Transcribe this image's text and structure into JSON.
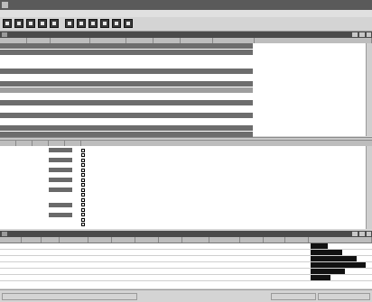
{
  "window": {
    "title": ""
  },
  "menu": [
    {
      "label": ""
    },
    {
      "label": ""
    },
    {
      "label": ""
    },
    {
      "label": ""
    },
    {
      "label": ""
    },
    {
      "label": ""
    },
    {
      "label": ""
    },
    {
      "label": ""
    }
  ],
  "toolbar": [
    {
      "icon": "start-capture-icon"
    },
    {
      "icon": "save-icon"
    },
    {
      "icon": "filter-icon"
    },
    {
      "icon": "stop-capture-icon"
    },
    {
      "icon": "restart-icon"
    },
    {
      "icon": "expert-icon"
    },
    {
      "icon": "options-icon"
    },
    {
      "icon": "print-icon"
    },
    {
      "icon": "list-view-icon"
    },
    {
      "icon": "statistics-icon"
    },
    {
      "icon": "help-icon"
    }
  ],
  "packet_pane": {
    "title": "",
    "columns": [
      "",
      "",
      "",
      "",
      "",
      "",
      "",
      "",
      ""
    ],
    "rows": [
      {
        "c": [
          "",
          "",
          "",
          "",
          "",
          "",
          "",
          "",
          ""
        ],
        "style": "dark"
      },
      {
        "c": [
          "",
          "",
          "",
          "",
          "",
          "",
          "",
          "",
          ""
        ],
        "style": "dark"
      },
      {
        "c": [
          "",
          "",
          "",
          "",
          "",
          "",
          "",
          "",
          ""
        ],
        "style": "light"
      },
      {
        "c": [
          "",
          "",
          "",
          "",
          "",
          "",
          "",
          "",
          ""
        ],
        "style": "light"
      },
      {
        "c": [
          "",
          "",
          "",
          "",
          "",
          "",
          "",
          "",
          ""
        ],
        "style": "dark"
      },
      {
        "c": [
          "",
          "",
          "",
          "",
          "",
          "",
          "",
          "",
          ""
        ],
        "style": "light"
      },
      {
        "c": [
          "",
          "",
          "",
          "",
          "",
          "",
          "",
          "",
          ""
        ],
        "style": "dark"
      },
      {
        "c": [
          "",
          "",
          "",
          "",
          "",
          "",
          "",
          "",
          ""
        ],
        "style": "sel"
      },
      {
        "c": [
          "",
          "",
          "",
          "",
          "",
          "",
          "",
          "",
          ""
        ],
        "style": "light"
      },
      {
        "c": [
          "",
          "",
          "",
          "",
          "",
          "",
          "",
          "",
          ""
        ],
        "style": "dark"
      },
      {
        "c": [
          "",
          "",
          "",
          "",
          "",
          "",
          "",
          "",
          ""
        ],
        "style": "light"
      },
      {
        "c": [
          "",
          "",
          "",
          "",
          "",
          "",
          "",
          "",
          ""
        ],
        "style": "dark"
      },
      {
        "c": [
          "",
          "",
          "",
          "",
          "",
          "",
          "",
          "",
          ""
        ],
        "style": "light"
      },
      {
        "c": [
          "",
          "",
          "",
          "",
          "",
          "",
          "",
          "",
          ""
        ],
        "style": "dark"
      },
      {
        "c": [
          "",
          "",
          "",
          "",
          "",
          "",
          "",
          "",
          ""
        ],
        "style": "dark"
      }
    ]
  },
  "detail_pane": {
    "title": "",
    "tabs": [
      {
        "label": ""
      },
      {
        "label": ""
      },
      {
        "label": ""
      },
      {
        "label": ""
      },
      {
        "label": ""
      }
    ],
    "lines": [
      {
        "hex": "",
        "box": true,
        "tree": ""
      },
      {
        "hex": "",
        "box": false,
        "tree": ""
      },
      {
        "hex": "",
        "box": true,
        "tree": ""
      },
      {
        "hex": "",
        "box": false,
        "tree": ""
      },
      {
        "hex": "",
        "box": true,
        "tree": ""
      },
      {
        "hex": "",
        "box": false,
        "tree": ""
      },
      {
        "hex": "",
        "box": true,
        "tree": ""
      },
      {
        "hex": "",
        "box": false,
        "tree": ""
      },
      {
        "hex": "",
        "box": true,
        "tree": ""
      },
      {
        "hex": "",
        "box": false,
        "tree": ""
      },
      {
        "hex": "",
        "box": false,
        "tree": ""
      },
      {
        "hex": "",
        "box": true,
        "tree": ""
      },
      {
        "hex": "",
        "box": false,
        "tree": ""
      },
      {
        "hex": "",
        "box": true,
        "tree": ""
      },
      {
        "hex": "",
        "box": false,
        "tree": ""
      },
      {
        "hex": "",
        "box": false,
        "tree": ""
      }
    ]
  },
  "stats_pane": {
    "title": "",
    "columns": [
      "",
      "",
      "",
      "",
      "",
      "",
      "",
      "",
      "",
      "",
      "",
      "",
      "",
      ""
    ],
    "rows": [
      {
        "c": [
          "",
          "",
          "",
          "",
          "",
          "",
          "",
          "",
          "",
          "",
          "",
          "",
          ""
        ],
        "bar": 0.3
      },
      {
        "c": [
          "",
          "",
          "",
          "",
          "",
          "",
          "",
          "",
          "",
          "",
          "",
          "",
          ""
        ],
        "bar": 0.55
      },
      {
        "c": [
          "",
          "",
          "",
          "",
          "",
          "",
          "",
          "",
          "",
          "",
          "",
          "",
          ""
        ],
        "bar": 0.8
      },
      {
        "c": [
          "",
          "",
          "",
          "",
          "",
          "",
          "",
          "",
          "",
          "",
          "",
          "",
          ""
        ],
        "bar": 0.95
      },
      {
        "c": [
          "",
          "",
          "",
          "",
          "",
          "",
          "",
          "",
          "",
          "",
          "",
          "",
          ""
        ],
        "bar": 0.6
      },
      {
        "c": [
          "",
          "",
          "",
          "",
          "",
          "",
          "",
          "",
          "",
          "",
          "",
          "",
          ""
        ],
        "bar": 0.35
      }
    ]
  },
  "status": {
    "left": "",
    "middle": "",
    "right": ""
  }
}
